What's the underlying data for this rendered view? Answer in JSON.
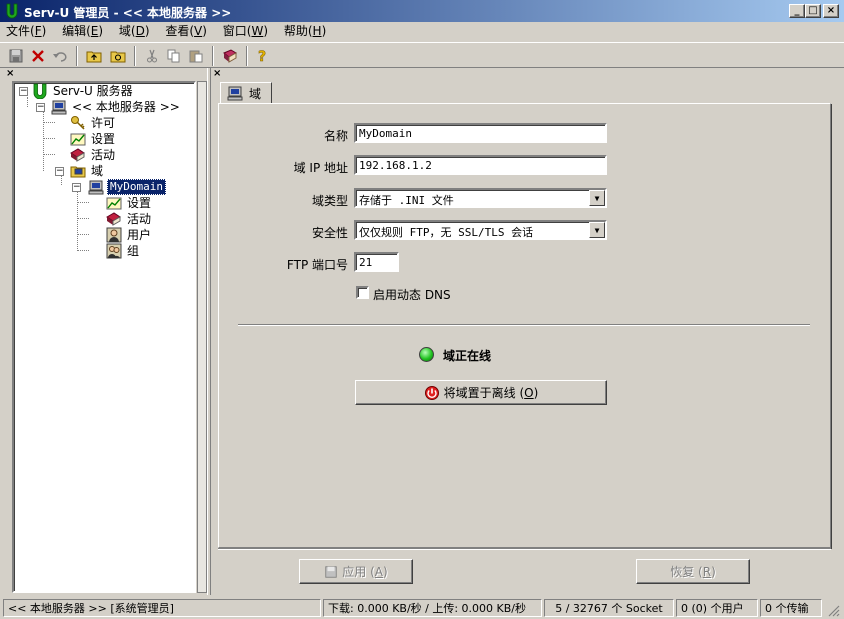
{
  "window": {
    "title": "Serv-U 管理员 - << 本地服务器 >>",
    "min_label": "_",
    "max_label": "□",
    "close_label": "×"
  },
  "menu": [
    {
      "label": "文件(",
      "key": "F",
      "end": ")"
    },
    {
      "label": "编辑(",
      "key": "E",
      "end": ")"
    },
    {
      "label": "域(",
      "key": "D",
      "end": ")"
    },
    {
      "label": "查看(",
      "key": "V",
      "end": ")"
    },
    {
      "label": "窗口(",
      "key": "W",
      "end": ")"
    },
    {
      "label": "帮助(",
      "key": "H",
      "end": ")"
    }
  ],
  "toolbar_icons": [
    "save-icon",
    "delete-icon",
    "undo-icon",
    "folder-up-icon",
    "folder-refresh-icon",
    "cut-icon",
    "copy-icon",
    "paste-icon",
    "book-icon",
    "help-icon"
  ],
  "pane_close": "×",
  "tree": {
    "root": "Serv-U 服务器",
    "server": "<< 本地服务器 >>",
    "license": "许可",
    "settings": "设置",
    "activity": "活动",
    "domains": "域",
    "domain_name": "MyDomain",
    "d_settings": "设置",
    "d_activity": "活动",
    "d_users": "用户",
    "d_groups": "组",
    "expander_minus": "−"
  },
  "tab_label": "域",
  "form": {
    "name_label": "名称",
    "name_value": "MyDomain",
    "ip_label": "域 IP 地址",
    "ip_value": "192.168.1.2",
    "type_label": "域类型",
    "type_value": "存储于 .INI 文件",
    "security_label": "安全性",
    "security_value": "仅仅规则 FTP，无 SSL/TLS 会话",
    "port_label": "FTP 端口号",
    "port_value": "21",
    "dns_label": "启用动态 DNS",
    "dns_checked": false,
    "online_status": "域正在线",
    "offline_button": "将域置于离线 (",
    "offline_key": "O",
    "offline_end": ")"
  },
  "buttons": {
    "apply": "应用 (",
    "apply_key": "A",
    "apply_end": ")",
    "reset": "恢复 (",
    "reset_key": "R",
    "reset_end": ")"
  },
  "status": {
    "server": "<< 本地服务器 >>  [系统管理员]",
    "transfer": "下载: 0.000 KB/秒 / 上传: 0.000 KB/秒",
    "sockets": "5 / 32767 个 Socket",
    "users": "0 (0) 个用户",
    "transfers": "0 个传输"
  },
  "colors": {
    "face": "#d4d0c8",
    "title_start": "#0a246a",
    "title_end": "#a6caf0",
    "online_led": "#22c422"
  }
}
